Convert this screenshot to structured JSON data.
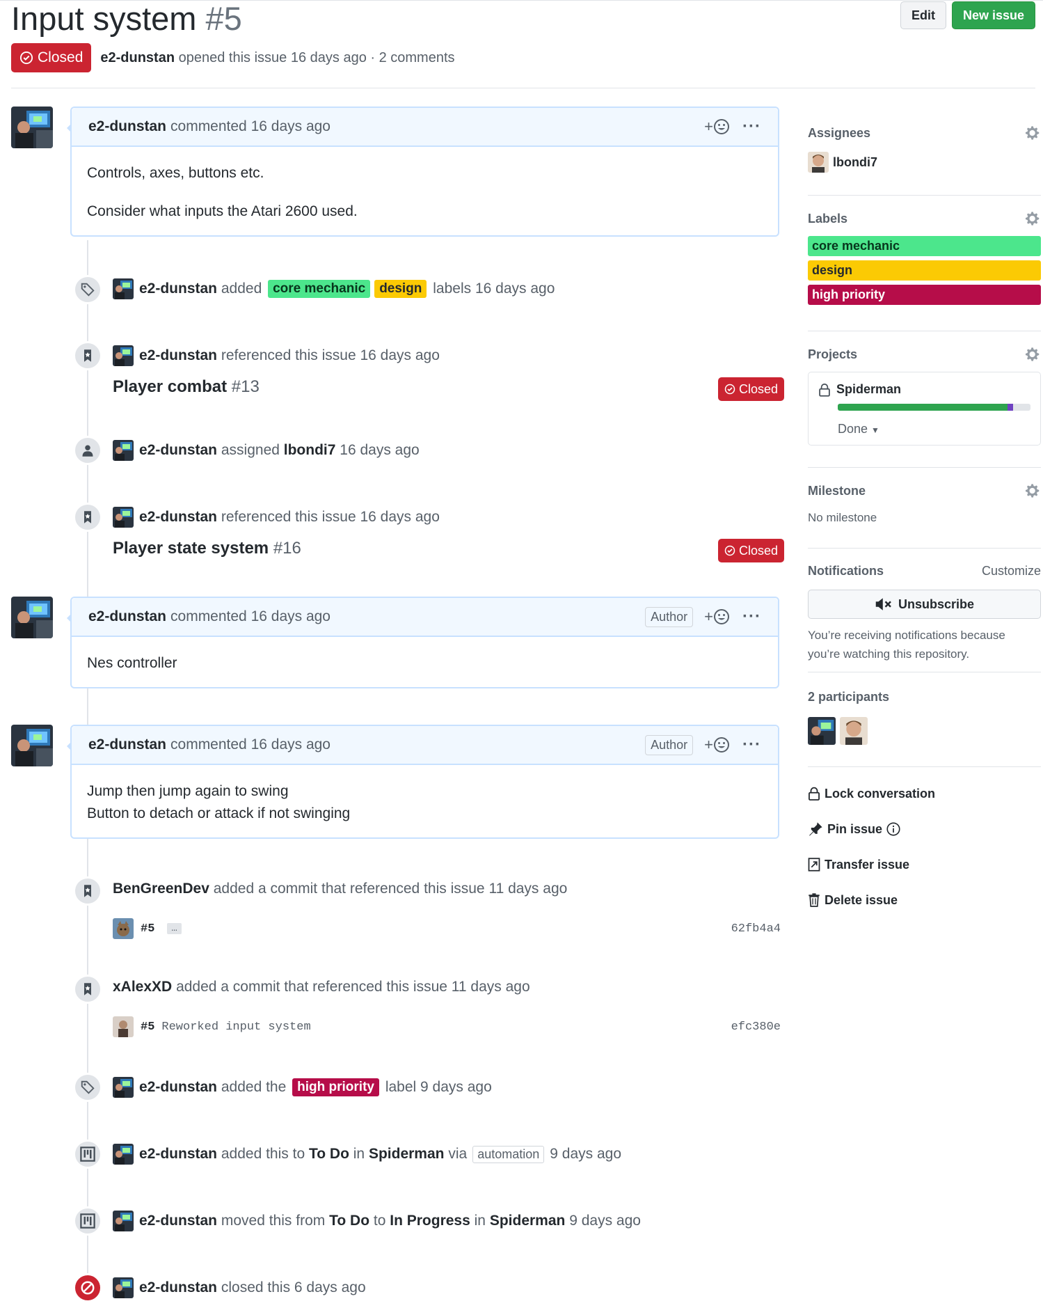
{
  "issue": {
    "title": "Input system",
    "number": "#5",
    "state": "Closed",
    "author": "e2-dunstan",
    "meta": "opened this issue 16 days ago · 2 comments"
  },
  "header_buttons": {
    "edit": "Edit",
    "new_issue": "New issue"
  },
  "comments": [
    {
      "author": "e2-dunstan",
      "meta": "commented 16 days ago",
      "author_badge": "",
      "lines": [
        "Controls, axes, buttons etc.",
        "Consider what inputs the Atari 2600 used."
      ]
    },
    {
      "author": "e2-dunstan",
      "meta": "commented 16 days ago",
      "author_badge": "Author",
      "lines": [
        "Nes controller"
      ]
    },
    {
      "author": "e2-dunstan",
      "meta": "commented 16 days ago",
      "author_badge": "Author",
      "lines": [
        "Jump then jump again to swing",
        "Button to detach or attack if not swinging"
      ]
    }
  ],
  "reaction_label": "+",
  "events": {
    "labels_added": {
      "actor": "e2-dunstan",
      "verb": "added",
      "label1": "core mechanic",
      "label2": "design",
      "tail": "labels 16 days ago"
    },
    "ref1": {
      "actor": "e2-dunstan",
      "text": "referenced this issue 16 days ago",
      "title": "Player combat",
      "num": "#13",
      "state": "Closed"
    },
    "assigned": {
      "actor": "e2-dunstan",
      "verb": "assigned",
      "target": "lbondi7",
      "time": "16 days ago"
    },
    "ref2": {
      "actor": "e2-dunstan",
      "text": "referenced this issue 16 days ago",
      "title": "Player state system",
      "num": "#16",
      "state": "Closed"
    },
    "commit1": {
      "actor": "BenGreenDev",
      "text": "added a commit that referenced this issue 11 days ago",
      "ref": "#5",
      "message": "",
      "ellipsis": "…",
      "sha": "62fb4a4"
    },
    "commit2": {
      "actor": "xAlexXD",
      "text": "added a commit that referenced this issue 11 days ago",
      "ref": "#5",
      "message": "Reworked input system",
      "sha": "efc380e"
    },
    "label_high": {
      "actor": "e2-dunstan",
      "verb": "added the",
      "label": "high priority",
      "tail": "label 9 days ago"
    },
    "project_add": {
      "actor": "e2-dunstan",
      "verb": "added this to",
      "column": "To Do",
      "in": "in",
      "project": "Spiderman",
      "via": "via",
      "pill": "automation",
      "time": "9 days ago"
    },
    "project_move": {
      "actor": "e2-dunstan",
      "verb": "moved this from",
      "from": "To Do",
      "to_word": "to",
      "to": "In Progress",
      "in": "in",
      "project": "Spiderman",
      "time": "9 days ago"
    },
    "closed": {
      "actor": "e2-dunstan",
      "text": "closed this 6 days ago"
    }
  },
  "sidebar": {
    "assignees": {
      "heading": "Assignees",
      "user": "lbondi7"
    },
    "labels": {
      "heading": "Labels",
      "items": [
        "core mechanic",
        "design",
        "high priority"
      ]
    },
    "projects": {
      "heading": "Projects",
      "name": "Spiderman",
      "status": "Done",
      "progress_done": 0.88,
      "progress_in_progress": 0.03
    },
    "milestone": {
      "heading": "Milestone",
      "value": "No milestone"
    },
    "notifications": {
      "heading": "Notifications",
      "customize": "Customize",
      "button": "Unsubscribe",
      "reason_line1": "You’re receiving notifications because",
      "reason_line2": "you’re watching this repository."
    },
    "participants": {
      "heading": "2 participants"
    },
    "actions": {
      "lock": "Lock conversation",
      "pin": "Pin issue",
      "transfer": "Transfer issue",
      "delete": "Delete issue"
    }
  },
  "colors": {
    "closed": "#cb2431",
    "green": "#2ea44f",
    "core_mechanic": "#4ce68c",
    "design": "#fbca04",
    "high_priority": "#b60d49"
  }
}
